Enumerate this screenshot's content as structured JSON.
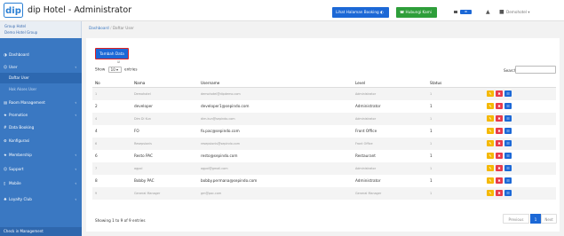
{
  "header": {
    "logo_text": "dip",
    "title": "dip Hotel - Administrator",
    "booking_button": "Lihat Halaman Booking ◐",
    "contact_button": "☎ Hubungi Kami",
    "lang_badge": "ID",
    "user_menu": "Demohotel ▾"
  },
  "sidebar": {
    "hotel_name": "Group Hotel",
    "group_name": "Demo Hotel Group",
    "items": [
      {
        "label": "Dashboard",
        "icon": "◑",
        "arrow": ""
      },
      {
        "label": "User",
        "icon": "☺",
        "arrow": "‹"
      },
      {
        "label": "Room Management",
        "icon": "▤",
        "arrow": "‹"
      },
      {
        "label": "Promotion",
        "icon": "★",
        "arrow": "‹"
      },
      {
        "label": "Data Booking",
        "icon": "#",
        "arrow": ""
      },
      {
        "label": "Konfigurasi",
        "icon": "⚙",
        "arrow": ""
      },
      {
        "label": "Membership",
        "icon": "★",
        "arrow": "‹"
      },
      {
        "label": "Support",
        "icon": "☺",
        "arrow": "‹"
      },
      {
        "label": "Mobile",
        "icon": "▯",
        "arrow": "‹"
      },
      {
        "label": "Loyalty Club",
        "icon": "♣",
        "arrow": "‹"
      }
    ],
    "subitems": [
      {
        "label": "Daftar User"
      },
      {
        "label": "Hak Akses User"
      }
    ],
    "bottom_item": "Check in Management"
  },
  "breadcrumb": {
    "home": "Dashboard",
    "sep": "/",
    "current": "Daftar User"
  },
  "toolbar": {
    "add_button": "Tambah Data",
    "mini_check": "☑"
  },
  "table_controls": {
    "show_label": "Show",
    "length_value": "10",
    "entries_label": "entries",
    "search_label": "Search:"
  },
  "table": {
    "columns": [
      "No",
      "Nama",
      "Username",
      "Level",
      "Status"
    ],
    "rows": [
      {
        "no": "1",
        "nama": "Demohotel",
        "username": "demohotel@dipdemo.com",
        "level": "Administrator",
        "status": "1",
        "faded": true
      },
      {
        "no": "2",
        "nama": "developer",
        "username": "developer1@sepindo.com",
        "level": "Administrator",
        "status": "1",
        "faded": false
      },
      {
        "no": "4",
        "nama": "Dim Di Kun",
        "username": "dim.kun@sepindo.com",
        "level": "Administrator",
        "status": "1",
        "faded": true
      },
      {
        "no": "4",
        "nama": "FO",
        "username": "fo.pac@sepindo.com",
        "level": "Front Office",
        "status": "1",
        "faded": false
      },
      {
        "no": "6",
        "nama": "Resepsionis",
        "username": "resepsionis@sepindo.com",
        "level": "Front Office",
        "status": "1",
        "faded": true
      },
      {
        "no": "6",
        "nama": "Resto PAC",
        "username": "resto@sepindo.com",
        "level": "Restaurant",
        "status": "1",
        "faded": false
      },
      {
        "no": "7",
        "nama": "agpol",
        "username": "agpol@gmail.com",
        "level": "Administrator",
        "status": "1",
        "faded": true
      },
      {
        "no": "8",
        "nama": "Bobby PAC",
        "username": "bobby.permana@sepindo.com",
        "level": "Administrator",
        "status": "1",
        "faded": false
      },
      {
        "no": "9",
        "nama": "General Manager",
        "username": "gm@pac.com",
        "level": "General Manager",
        "status": "1",
        "faded": true
      }
    ],
    "actions": {
      "edit": "✎",
      "delete": "✖",
      "view": "☷"
    }
  },
  "footer": {
    "info": "Showing 1 to 9 of 9 entries",
    "prev": "Previous",
    "page": "1",
    "next": "Next"
  },
  "colors": {
    "sidebar": "#3a78c2",
    "primary": "#1c68d6",
    "success": "#2e9e3a",
    "edit": "#f5b800",
    "delete": "#e83a4a"
  }
}
